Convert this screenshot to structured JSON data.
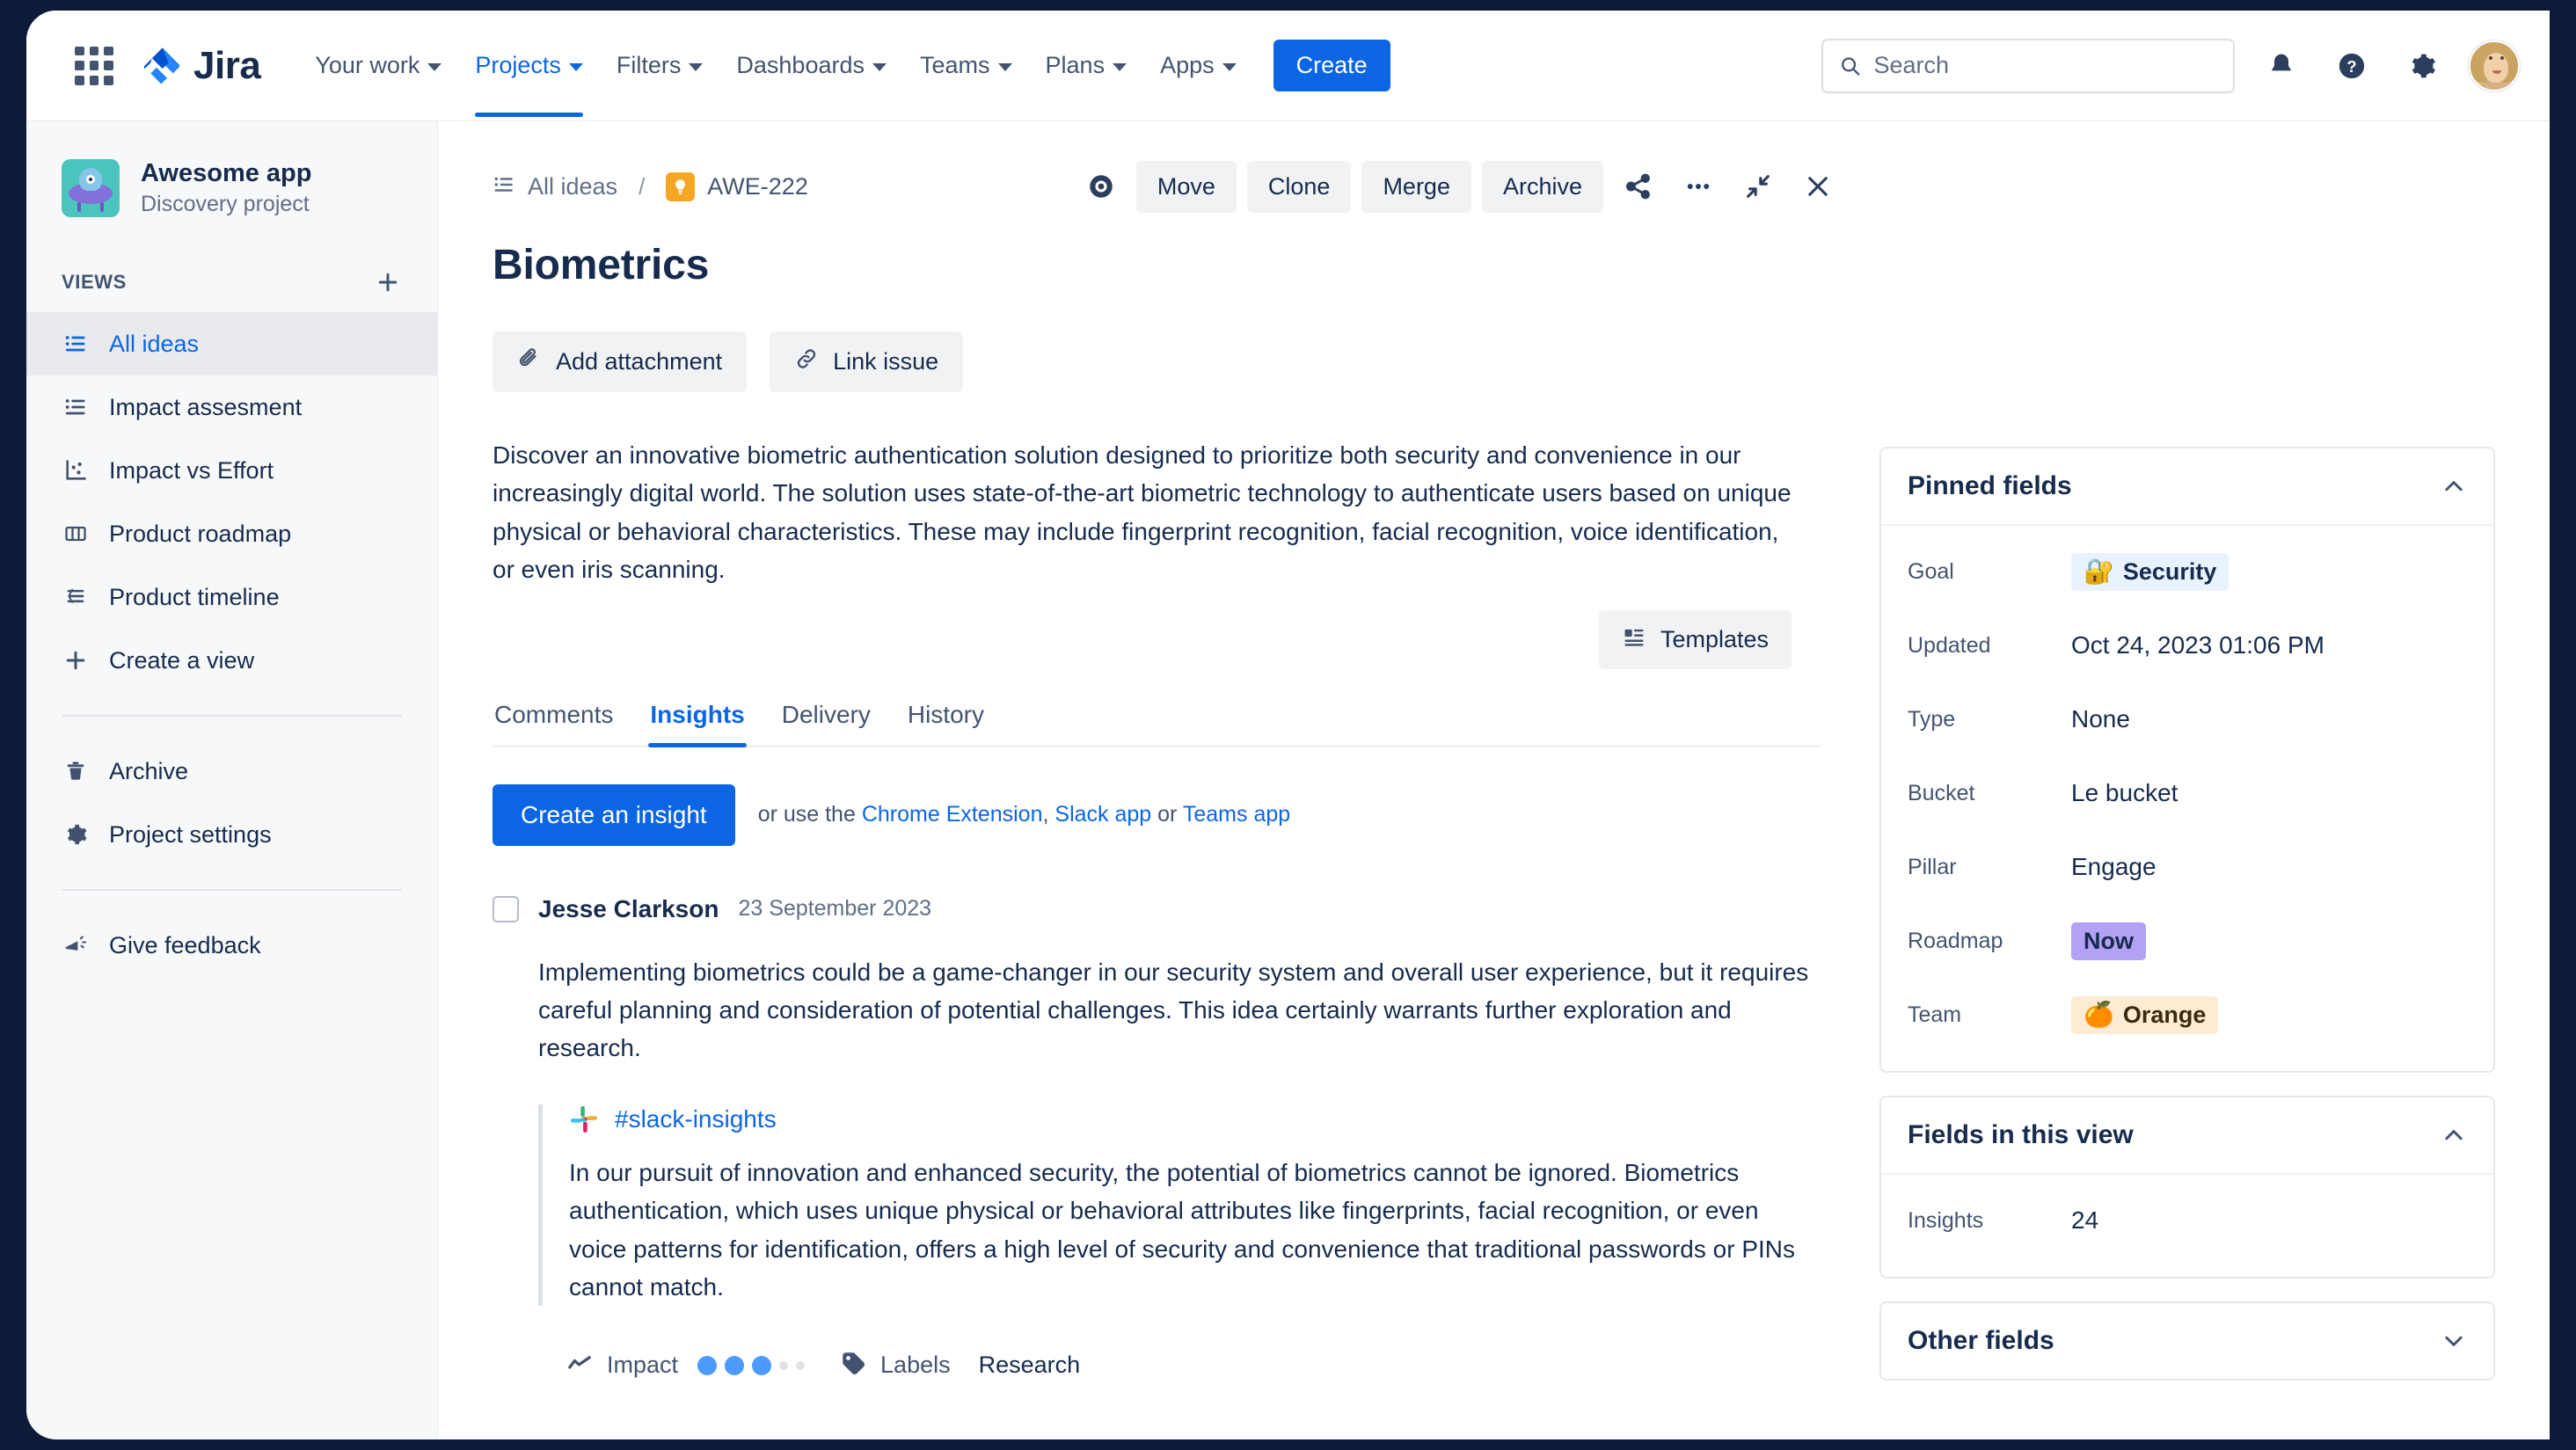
{
  "topnav": {
    "app_switcher_icon": "grid-apps-icon",
    "logo_text": "Jira",
    "items": [
      {
        "label": "Your work",
        "has_chevron": true,
        "active": false
      },
      {
        "label": "Projects",
        "has_chevron": true,
        "active": true
      },
      {
        "label": "Filters",
        "has_chevron": true,
        "active": false
      },
      {
        "label": "Dashboards",
        "has_chevron": true,
        "active": false
      },
      {
        "label": "Teams",
        "has_chevron": true,
        "active": false
      },
      {
        "label": "Plans",
        "has_chevron": true,
        "active": false
      },
      {
        "label": "Apps",
        "has_chevron": true,
        "active": false
      }
    ],
    "create_label": "Create",
    "search_placeholder": "Search",
    "search_value": "",
    "right_icons": [
      "notifications-bell-icon",
      "help-question-icon",
      "settings-gear-icon",
      "user-avatar"
    ]
  },
  "sidebar": {
    "project_name": "Awesome app",
    "project_type": "Discovery project",
    "project_avatar_icon": "ufo-alien-icon",
    "section_label": "VIEWS",
    "add_view_icon": "plus-icon",
    "views": [
      {
        "label": "All ideas",
        "icon": "list-view-icon",
        "selected": true
      },
      {
        "label": "Impact assesment",
        "icon": "list-view-icon",
        "selected": false
      },
      {
        "label": "Impact vs Effort",
        "icon": "scatter-chart-icon",
        "selected": false
      },
      {
        "label": "Product roadmap",
        "icon": "board-columns-icon",
        "selected": false
      },
      {
        "label": "Product timeline",
        "icon": "timeline-icon",
        "selected": false
      },
      {
        "label": "Create a view",
        "icon": "plus-icon",
        "selected": false
      }
    ],
    "secondary": [
      {
        "label": "Archive",
        "icon": "trash-icon"
      },
      {
        "label": "Project settings",
        "icon": "gear-icon"
      }
    ],
    "feedback": {
      "label": "Give feedback",
      "icon": "megaphone-icon"
    }
  },
  "breadcrumb": {
    "view_icon": "list-view-icon",
    "view_label": "All ideas",
    "separator": "/",
    "idea_icon": "lightbulb-icon",
    "issue_key": "AWE-222"
  },
  "header_actions": {
    "watch_icon": "eye-watch-icon",
    "buttons": [
      "Move",
      "Clone",
      "Merge",
      "Archive"
    ],
    "share_icon": "share-icon",
    "more_icon": "more-ellipsis-icon",
    "collapse_icon": "collapse-arrows-icon",
    "close_icon": "close-x-icon"
  },
  "issue": {
    "title": "Biometrics",
    "add_attachment_label": "Add attachment",
    "attachment_icon": "paperclip-icon",
    "link_issue_label": "Link issue",
    "link_icon": "link-chain-icon",
    "description": "Discover an innovative biometric authentication solution designed to prioritize both security and convenience in our increasingly digital world. The solution uses state-of-the-art biometric technology to authenticate users based on unique physical or behavioral characteristics. These may include fingerprint recognition, facial recognition, voice identification, or even iris scanning.",
    "templates_label": "Templates",
    "templates_icon": "template-layout-icon"
  },
  "tabs": [
    {
      "label": "Comments",
      "active": false
    },
    {
      "label": "Insights",
      "active": true
    },
    {
      "label": "Delivery",
      "active": false
    },
    {
      "label": "History",
      "active": false
    }
  ],
  "insights_panel": {
    "create_button": "Create an insight",
    "cta_prefix": "or use the ",
    "link_chrome": "Chrome Extension",
    "cta_comma": ", ",
    "link_slack": "Slack app",
    "cta_or": " or ",
    "link_teams": "Teams app",
    "insight": {
      "author": "Jesse Clarkson",
      "date": "23 September 2023",
      "body": "Implementing biometrics could be a game-changer in our security system and overall user experience, but it requires careful planning and consideration of potential challenges. This idea certainly warrants further exploration and research.",
      "quote": {
        "source_icon": "slack-icon",
        "channel": "#slack-insights",
        "text": "In our pursuit of innovation and enhanced security, the potential of biometrics cannot be ignored. Biometrics authentication, which uses unique physical or behavioral attributes like fingerprints, facial recognition, or even voice patterns for identification, offers a high level of security and convenience that traditional passwords or PINs cannot match."
      },
      "meta": {
        "impact_icon": "trend-line-icon",
        "impact_label": "Impact",
        "impact_filled": 3,
        "impact_empty": 2,
        "labels_icon": "tag-icon",
        "labels_label": "Labels",
        "labels_value": "Research"
      }
    }
  },
  "right_panel": {
    "pinned_fields": {
      "title": "Pinned fields",
      "collapse_icon": "chevron-up-icon",
      "fields": [
        {
          "label": "Goal",
          "value": "Security",
          "type": "pill-goal",
          "emoji": "🔐"
        },
        {
          "label": "Updated",
          "value": "Oct 24, 2023 01:06 PM",
          "type": "text"
        },
        {
          "label": "Type",
          "value": "None",
          "type": "text"
        },
        {
          "label": "Bucket",
          "value": "Le bucket",
          "type": "text"
        },
        {
          "label": "Pillar",
          "value": "Engage",
          "type": "text"
        },
        {
          "label": "Roadmap",
          "value": "Now",
          "type": "pill-roadmap"
        },
        {
          "label": "Team",
          "value": "Orange",
          "type": "pill-team",
          "emoji": "🍊"
        }
      ]
    },
    "fields_in_view": {
      "title": "Fields in this view",
      "collapse_icon": "chevron-up-icon",
      "fields": [
        {
          "label": "Insights",
          "value": "24"
        }
      ]
    },
    "other_fields": {
      "title": "Other fields",
      "expand_icon": "chevron-down-icon"
    }
  },
  "colors": {
    "brand_blue": "#0c66e4",
    "text_primary": "#172b4d",
    "text_subtle": "#44546f",
    "surface_frame": "#0d1b38",
    "roadmap_pill": "#b3a1f5",
    "team_pill": "#fdebd4",
    "idea_badge": "#f5a623",
    "project_avatar": "#4bc4bd"
  }
}
